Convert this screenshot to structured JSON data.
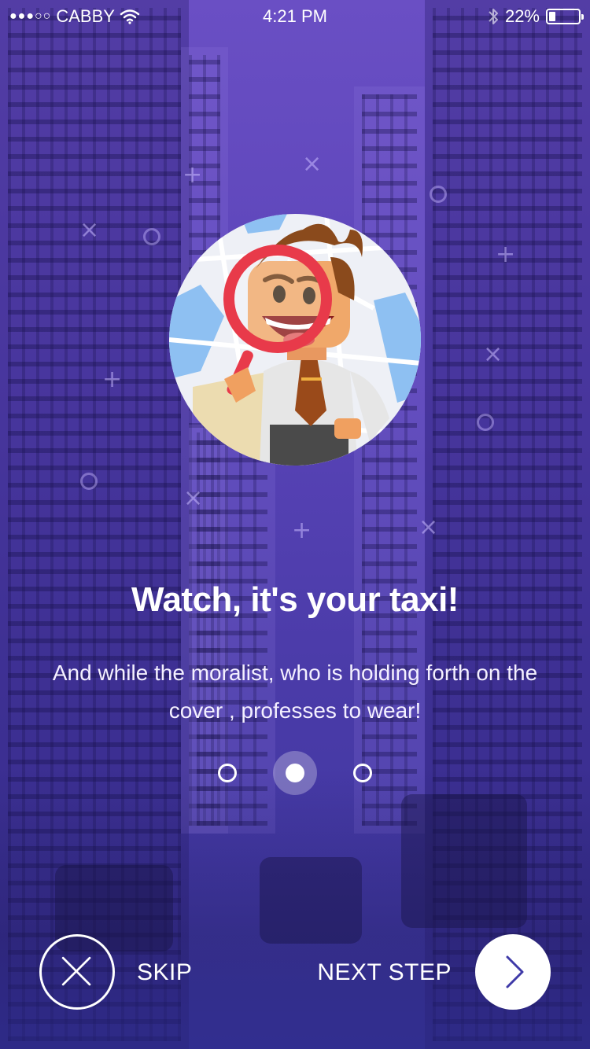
{
  "status_bar": {
    "signal": "●●●○○",
    "carrier": "CABBY",
    "time": "4:21 PM",
    "battery_percent": "22%",
    "battery_level": 0.22,
    "icons": [
      "wifi-icon",
      "bluetooth-icon",
      "battery-icon"
    ]
  },
  "onboarding": {
    "title": "Watch, it's your taxi!",
    "description": "And while the moralist, who is holding forth on the cover , professes to wear!",
    "page_count": 3,
    "active_page": 2
  },
  "actions": {
    "skip_label": "SKIP",
    "next_label": "NEXT STEP"
  },
  "colors": {
    "background_top": "#6a4fc4",
    "background_bottom": "#3c36a0",
    "accent": "#3f3aa8",
    "magnifier": "#e83a4a"
  }
}
